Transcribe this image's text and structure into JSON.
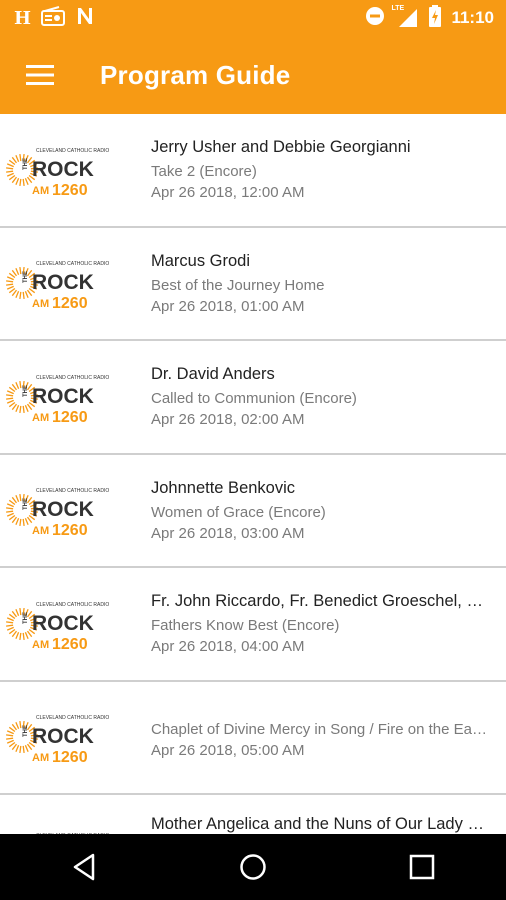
{
  "status_bar": {
    "left_icons": [
      "h-app-icon",
      "radio-icon",
      "n-app-icon"
    ],
    "right_icons": [
      "do-not-disturb-icon",
      "lte-signal-icon",
      "battery-charging-icon"
    ],
    "lte_label": "LTE",
    "time": "11:10"
  },
  "app_bar": {
    "title": "Program Guide",
    "menu_icon": "hamburger-menu-icon"
  },
  "colors": {
    "accent": "#f79a14",
    "logo_dark": "#333333"
  },
  "logo": {
    "tagline": "CLEVELAND CATHOLIC RADIO",
    "the": "THE",
    "rock": "ROCK",
    "am": "AM",
    "freq": "1260"
  },
  "programs": [
    {
      "host": "Jerry Usher and Debbie Georgianni",
      "title": "Take 2 (Encore)",
      "time": "Apr 26 2018, 12:00 AM"
    },
    {
      "host": "Marcus Grodi",
      "title": "Best of the Journey Home",
      "time": "Apr 26 2018, 01:00 AM"
    },
    {
      "host": "Dr. David Anders",
      "title": "Called to Communion (Encore)",
      "time": "Apr 26 2018, 02:00 AM"
    },
    {
      "host": "Johnnette Benkovic",
      "title": "Women of Grace (Encore)",
      "time": "Apr 26 2018, 03:00 AM"
    },
    {
      "host": "Fr. John Riccardo, Fr. Benedict Groeschel, a…",
      "title": "Fathers Know Best (Encore)",
      "time": "Apr 26 2018, 04:00 AM"
    },
    {
      "host": "",
      "title": "Chaplet of Divine Mercy in Song / Fire on the Ea…",
      "time": "Apr 26 2018, 05:00 AM"
    },
    {
      "host": "Mother Angelica and the Nuns of Our Lady …",
      "title": "",
      "time": ""
    }
  ],
  "nav_bar": {
    "buttons": [
      "back-icon",
      "home-icon",
      "recents-icon"
    ]
  }
}
